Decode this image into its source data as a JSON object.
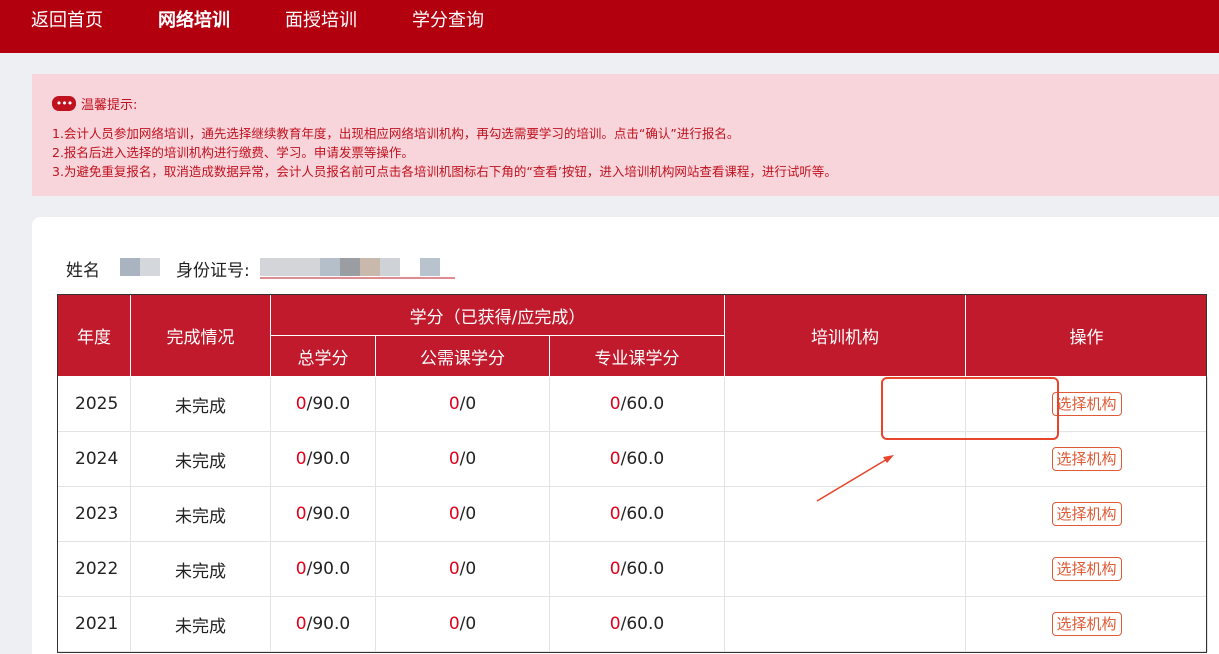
{
  "nav": {
    "items": [
      {
        "label": "返回首页",
        "active": false
      },
      {
        "label": "网络培训",
        "active": true
      },
      {
        "label": "面授培训",
        "active": false
      },
      {
        "label": "学分查询",
        "active": false
      }
    ]
  },
  "notice": {
    "icon": "ellipsis-icon",
    "title": "温馨提示:",
    "lines": [
      "1.会计人员参加网络培训，通先选择继续教育年度，出现相应网络培训机构，再勾选需要学习的培训。点击“确认”进行报名。",
      "2.报名后进入选择的培训机构进行缴费、学习。申请发票等操作。",
      "3.为避免重复报名，取消造成数据异常，会计人员报名前可点击各培训机图标右下角的“查看’按钮，进入培训机构网站查看课程，进行试听等。"
    ]
  },
  "person": {
    "name_label": "姓名",
    "id_label": "身份证号:"
  },
  "table": {
    "headers": {
      "year": "年度",
      "status": "完成情况",
      "credits_group": "学分（已获得/应完成）",
      "total": "总学分",
      "public": "公需课学分",
      "professional": "专业课学分",
      "institution": "培训机构",
      "action": "操作"
    },
    "rows": [
      {
        "year": "2025",
        "status": "未完成",
        "total_got": "0",
        "total_req": "/90.0",
        "public_got": "0",
        "public_req": "/0",
        "pro_got": "0",
        "pro_req": "/60.0",
        "action": "选择机构"
      },
      {
        "year": "2024",
        "status": "未完成",
        "total_got": "0",
        "total_req": "/90.0",
        "public_got": "0",
        "public_req": "/0",
        "pro_got": "0",
        "pro_req": "/60.0",
        "action": "选择机构"
      },
      {
        "year": "2023",
        "status": "未完成",
        "total_got": "0",
        "total_req": "/90.0",
        "public_got": "0",
        "public_req": "/0",
        "pro_got": "0",
        "pro_req": "/60.0",
        "action": "选择机构"
      },
      {
        "year": "2022",
        "status": "未完成",
        "total_got": "0",
        "total_req": "/90.0",
        "public_got": "0",
        "public_req": "/0",
        "pro_got": "0",
        "pro_req": "/60.0",
        "action": "选择机构"
      },
      {
        "year": "2021",
        "status": "未完成",
        "total_got": "0",
        "total_req": "/90.0",
        "public_got": "0",
        "public_req": "/0",
        "pro_got": "0",
        "pro_req": "/60.0",
        "action": "选择机构"
      }
    ]
  },
  "colors": {
    "brand": "#b3000f",
    "header_bg": "#c01a2c",
    "notice_bg": "#f8d5da",
    "notice_text": "#c0111f",
    "zero": "#e0001b",
    "button": "#e05a35",
    "annotation": "#e8432b"
  }
}
